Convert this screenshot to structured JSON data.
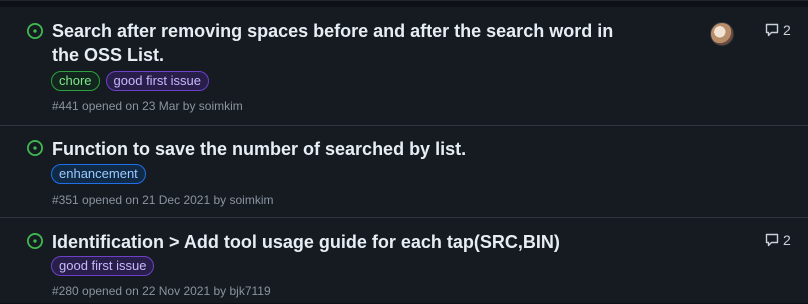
{
  "issues": [
    {
      "title": "Search after removing spaces before and after the search word in the OSS List.",
      "labels": [
        "chore",
        "good first issue"
      ],
      "meta": "#441 opened on 23 Mar by soimkim",
      "comments": "2",
      "has_avatar": true
    },
    {
      "title": "Function to save the number of searched by list.",
      "labels": [
        "enhancement"
      ],
      "meta": "#351 opened on 21 Dec 2021 by soimkim"
    },
    {
      "title": "Identification > Add tool usage guide for each tap(SRC,BIN)",
      "labels": [
        "good first issue"
      ],
      "meta": "#280 opened on 22 Nov 2021 by bjk7119",
      "comments": "2"
    }
  ],
  "colors": {
    "open_icon": "#3fb950",
    "background": "#161b22",
    "border": "#30363d"
  },
  "icons": {
    "status": "issue-opened-icon",
    "comment": "comment-icon"
  }
}
